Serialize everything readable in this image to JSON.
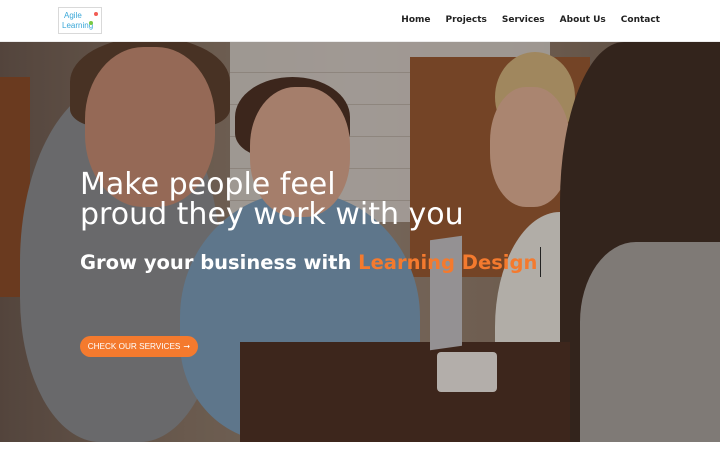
{
  "brand": {
    "logo_line1": "Agile",
    "logo_line2": "Learning"
  },
  "nav": {
    "items": [
      {
        "label": "Home"
      },
      {
        "label": "Projects"
      },
      {
        "label": "Services"
      },
      {
        "label": "About Us"
      },
      {
        "label": "Contact"
      }
    ]
  },
  "hero": {
    "headline_line1": "Make people feel",
    "headline_line2": "proud they work with you",
    "subhead_prefix": "Grow your business with ",
    "subhead_accent": "Learning Design",
    "cta_label": "CHECK OUR SERVICES",
    "cta_arrow": "➞"
  },
  "colors": {
    "accent": "#f47a2e",
    "text_dark": "#222222",
    "white": "#ffffff"
  },
  "icons": {
    "cta_arrow": "arrow-right-icon",
    "logo": "agile-learning-logo"
  }
}
